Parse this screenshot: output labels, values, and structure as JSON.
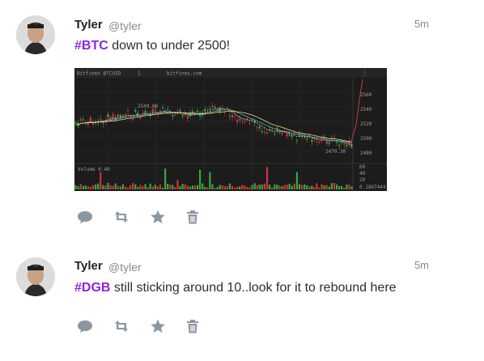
{
  "posts": [
    {
      "author": "Tyler",
      "handle": "@tyler",
      "time": "5m",
      "hashtag": "#BTC",
      "text": " down to under 2500!",
      "has_chart": true,
      "actions": [
        "reply-icon",
        "retweet-icon",
        "star-icon",
        "trash-icon"
      ]
    },
    {
      "author": "Tyler",
      "handle": "@tyler",
      "time": "5m",
      "hashtag": "#DGB",
      "text": " still sticking around 10..look for it to rebound here",
      "has_chart": false,
      "actions": [
        "reply-icon",
        "retweet-icon",
        "star-icon",
        "trash-icon"
      ]
    }
  ],
  "chart_image": {
    "symbol": "Bitfinex BTCUSD",
    "interval": "1",
    "source": "bitfinex.com",
    "price_ticks": [
      "2560",
      "2540",
      "2520",
      "2500",
      "2480"
    ],
    "high_label": "2549.08",
    "low_label": "2479.30",
    "volume_label": "Volume 0.40",
    "volume_ticks": [
      "60",
      "40",
      "20",
      "0.1867444"
    ]
  },
  "colors": {
    "hashtag": "#8e24e0",
    "icon": "#8c96a0",
    "chart_bg": "#1c1c1c",
    "up": "#39a845",
    "down": "#d03636"
  }
}
